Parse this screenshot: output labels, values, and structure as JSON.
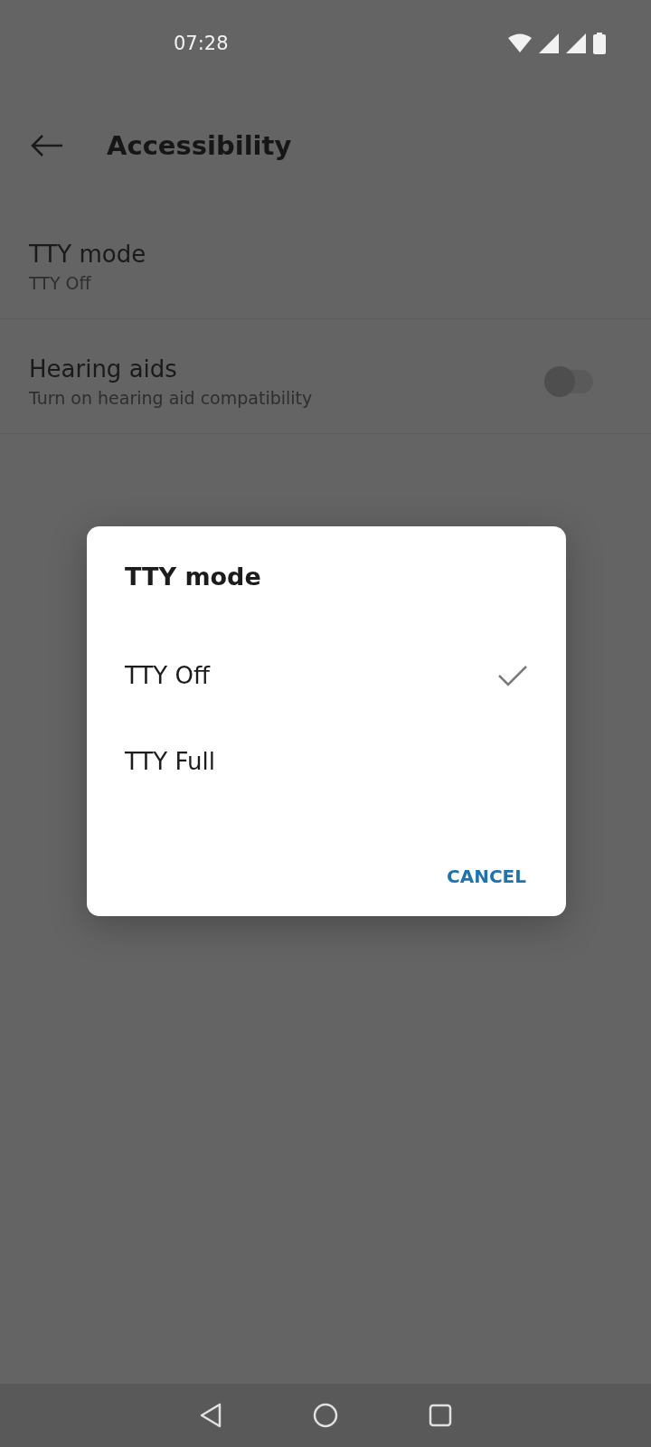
{
  "status_bar": {
    "time": "07:28"
  },
  "header": {
    "title": "Accessibility"
  },
  "settings": [
    {
      "kind": "link",
      "title": "TTY mode",
      "summary": "TTY Off"
    },
    {
      "kind": "toggle",
      "title": "Hearing aids",
      "summary": "Turn on hearing aid compatibility",
      "on": false
    }
  ],
  "dialog": {
    "title": "TTY mode",
    "options": [
      {
        "label": "TTY Off",
        "selected": true
      },
      {
        "label": "TTY Full",
        "selected": false
      }
    ],
    "buttons": [
      "CANCEL"
    ]
  }
}
